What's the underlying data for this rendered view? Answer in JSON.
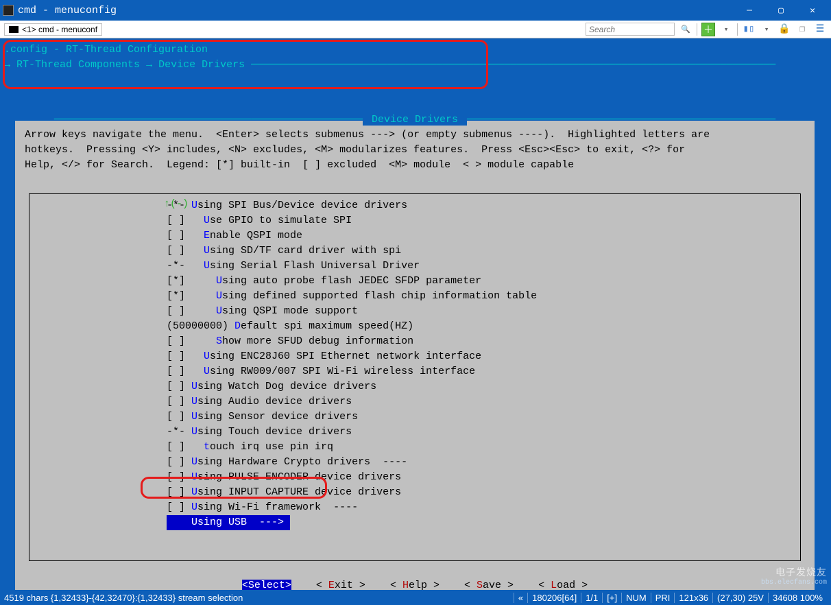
{
  "window": {
    "title": "cmd - menuconfig",
    "tab_label": "<1> cmd - menuconf"
  },
  "toolbar": {
    "search_placeholder": "Search"
  },
  "breadcrumb": {
    "config_line": ".config - RT-Thread Configuration",
    "arrow": "→",
    "path1": "RT-Thread Components",
    "path2": "Device Drivers"
  },
  "panel": {
    "title": "Device Drivers",
    "help": "Arrow keys navigate the menu.  <Enter> selects submenus ---> (or empty submenus ----).  Highlighted letters are\nhotkeys.  Pressing <Y> includes, <N> excludes, <M> modularizes features.  Press <Esc><Esc> to exit, <?> for\nHelp, </> for Search.  Legend: [*] built-in  [ ] excluded  <M> module  < > module capable",
    "scroll_indicator": "↑(-)",
    "items": [
      {
        "prefix": "-*- ",
        "hot": "U",
        "rest": "sing SPI Bus/Device device drivers"
      },
      {
        "prefix": "[ ]   ",
        "hot": "U",
        "rest": "se GPIO to simulate SPI"
      },
      {
        "prefix": "[ ]   ",
        "hot": "E",
        "rest": "nable QSPI mode"
      },
      {
        "prefix": "[ ]   ",
        "hot": "U",
        "rest": "sing SD/TF card driver with spi"
      },
      {
        "prefix": "-*-   ",
        "hot": "U",
        "rest": "sing Serial Flash Universal Driver"
      },
      {
        "prefix": "[*]     ",
        "hot": "U",
        "rest": "sing auto probe flash JEDEC SFDP parameter"
      },
      {
        "prefix": "[*]     ",
        "hot": "U",
        "rest": "sing defined supported flash chip information table"
      },
      {
        "prefix": "[ ]     ",
        "hot": "U",
        "rest": "sing QSPI mode support"
      },
      {
        "prefix": "(50000000) ",
        "hot": "D",
        "rest": "efault spi maximum speed(HZ)"
      },
      {
        "prefix": "[ ]     ",
        "hot": "S",
        "rest": "how more SFUD debug information"
      },
      {
        "prefix": "[ ]   ",
        "hot": "U",
        "rest": "sing ENC28J60 SPI Ethernet network interface"
      },
      {
        "prefix": "[ ]   ",
        "hot": "U",
        "rest": "sing RW009/007 SPI Wi-Fi wireless interface"
      },
      {
        "prefix": "[ ] ",
        "hot": "U",
        "rest": "sing Watch Dog device drivers"
      },
      {
        "prefix": "[ ] ",
        "hot": "U",
        "rest": "sing Audio device drivers"
      },
      {
        "prefix": "[ ] ",
        "hot": "U",
        "rest": "sing Sensor device drivers"
      },
      {
        "prefix": "-*- ",
        "hot": "U",
        "rest": "sing Touch device drivers"
      },
      {
        "prefix": "[ ]   ",
        "hot": "t",
        "rest": "ouch irq use pin irq"
      },
      {
        "prefix": "[ ] ",
        "hot": "U",
        "rest": "sing Hardware Crypto drivers  ----"
      },
      {
        "prefix": "[ ] ",
        "hot": "U",
        "rest": "sing PULSE ENCODER device drivers"
      },
      {
        "prefix": "[ ] ",
        "hot": "U",
        "rest": "sing INPUT CAPTURE device drivers"
      },
      {
        "prefix": "[ ] ",
        "hot": "U",
        "rest": "sing Wi-Fi framework  ----"
      },
      {
        "prefix": "    ",
        "hot": "U",
        "rest": "sing USB  --->",
        "selected": true
      }
    ],
    "buttons": {
      "select": "<Select>",
      "exit_pre": "< ",
      "exit_hot": "E",
      "exit_post": "xit >",
      "help_pre": "< ",
      "help_hot": "H",
      "help_post": "elp >",
      "save_pre": "< ",
      "save_hot": "S",
      "save_post": "ave >",
      "load_pre": "< ",
      "load_hot": "L",
      "load_post": "oad >"
    }
  },
  "statusbar": {
    "left": "4519 chars {1,32433}-{42,32470}:{1,32433} stream selection",
    "seg1": "«",
    "seg2": "180206[64]",
    "seg3": "1/1",
    "seg4": "[+]",
    "seg5": "NUM",
    "seg6": "PRI",
    "seg7": "121x36",
    "seg8": "(27,30) 25V",
    "seg9": "34608 100%"
  },
  "watermark": {
    "line1": "电子发烧友",
    "line2": "bbs.elecfans.com"
  }
}
